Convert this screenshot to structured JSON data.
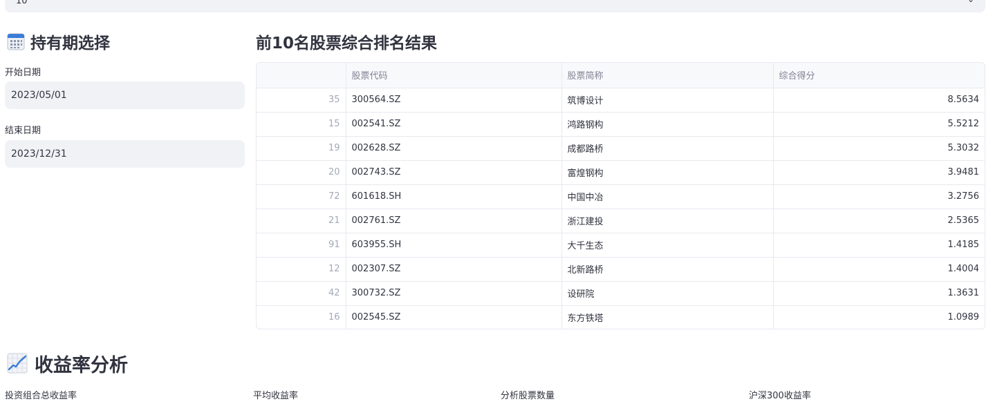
{
  "top_select": {
    "value": "10"
  },
  "holding_period": {
    "title": "持有期选择",
    "icon": "calendar-icon",
    "start_label": "开始日期",
    "start_value": "2023/05/01",
    "end_label": "结束日期",
    "end_value": "2023/12/31"
  },
  "ranking": {
    "title": "前10名股票综合排名结果",
    "columns": [
      "",
      "股票代码",
      "股票简称",
      "综合得分"
    ],
    "rows": [
      [
        "35",
        "300564.SZ",
        "筑博设计",
        "8.5634"
      ],
      [
        "15",
        "002541.SZ",
        "鸿路钢构",
        "5.5212"
      ],
      [
        "19",
        "002628.SZ",
        "成都路桥",
        "5.3032"
      ],
      [
        "20",
        "002743.SZ",
        "富煌钢构",
        "3.9481"
      ],
      [
        "72",
        "601618.SH",
        "中国中冶",
        "3.2756"
      ],
      [
        "21",
        "002761.SZ",
        "浙江建投",
        "2.5365"
      ],
      [
        "91",
        "603955.SH",
        "大千生态",
        "1.4185"
      ],
      [
        "12",
        "002307.SZ",
        "北新路桥",
        "1.4004"
      ],
      [
        "42",
        "300732.SZ",
        "设研院",
        "1.3631"
      ],
      [
        "16",
        "002545.SZ",
        "东方铁塔",
        "1.0989"
      ]
    ]
  },
  "returns": {
    "title": "收益率分析",
    "icon": "chart-increasing-icon",
    "metrics": [
      "投资组合总收益率",
      "平均收益率",
      "分析股票数量",
      "沪深300收益率"
    ]
  },
  "colors": {
    "input_bg": "#f0f2f6",
    "border": "#e6e9ef",
    "text": "#31333f",
    "muted": "#808495"
  }
}
